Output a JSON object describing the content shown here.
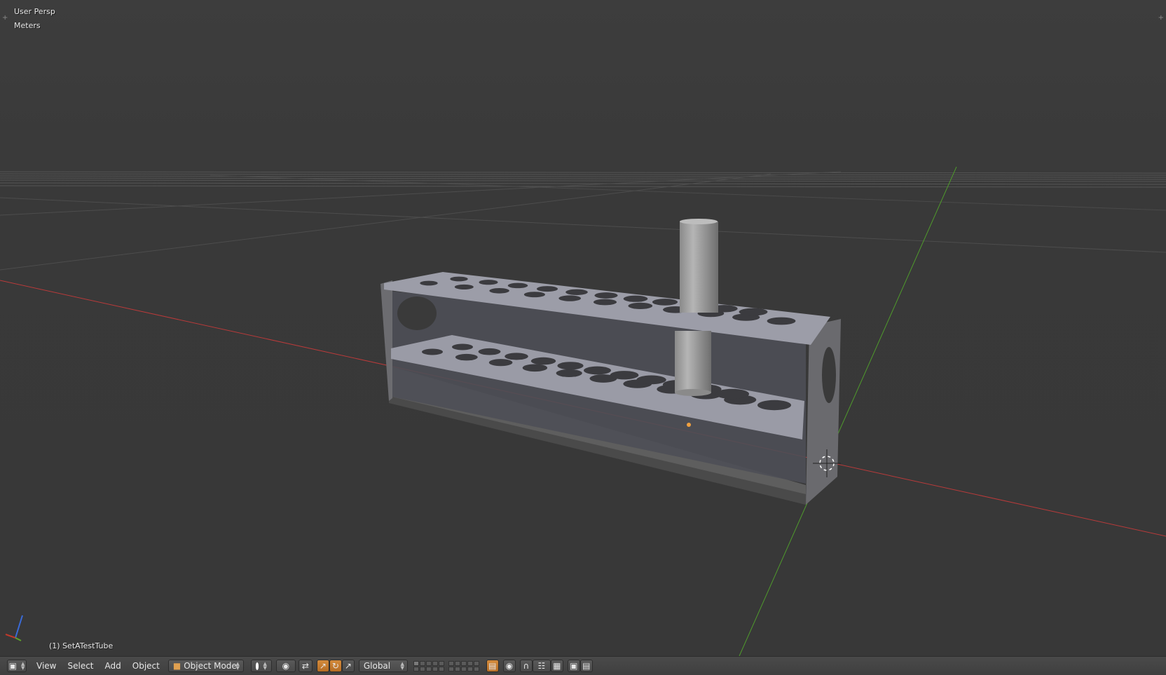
{
  "viewport": {
    "view_name": "User Persp",
    "units": "Meters",
    "active_object": "(1) SetATestTube"
  },
  "header": {
    "editor_type_icon": "3d-view-cube-icon",
    "menus": [
      "View",
      "Select",
      "Add",
      "Object"
    ],
    "mode": {
      "label": "Object Mode",
      "icon": "object-cube-icon"
    },
    "shading_icon": "solid-sphere-icon",
    "pivot_icon": "pivot-point-icon",
    "manipulator_icons": [
      "manipulator-toggle-icon",
      "translate-icon",
      "rotate-icon",
      "scale-icon"
    ],
    "orientation": "Global",
    "snap_icons": [
      "snap-icon",
      "snap-element-icon"
    ],
    "render_icons": [
      "opengl-render-icon",
      "opengl-animation-icon"
    ]
  },
  "colors": {
    "x_axis": "#c0392b",
    "y_axis": "#5fa32b",
    "active_toggle": "#c47a2e",
    "object": "#8b8b8b"
  }
}
